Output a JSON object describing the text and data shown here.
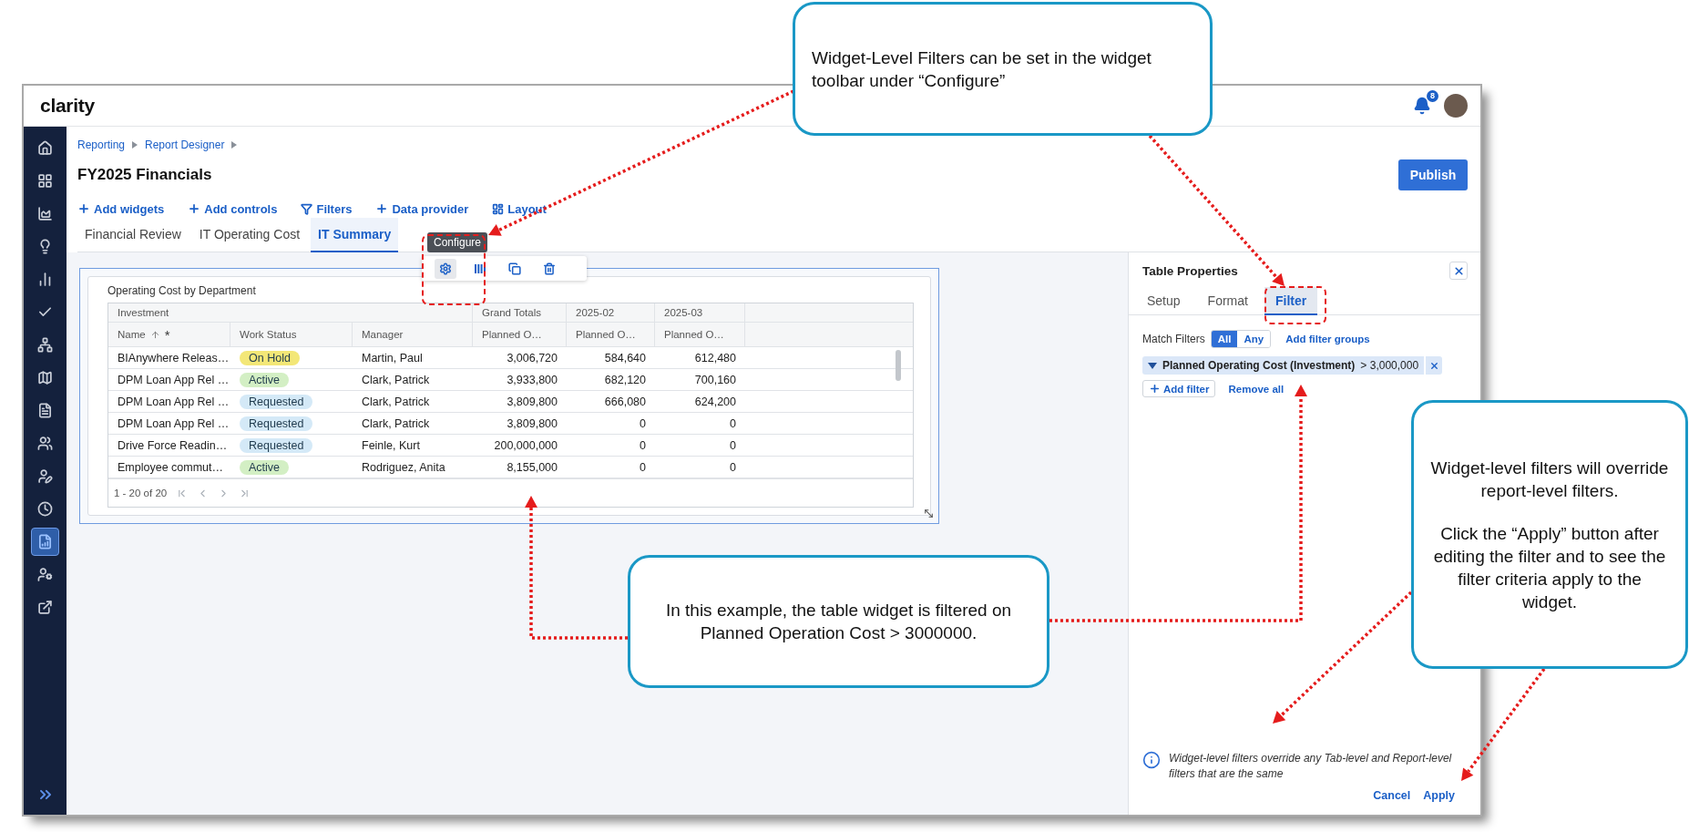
{
  "header": {
    "logo": "clarity",
    "notification_count": "8"
  },
  "sidebar": {
    "items": [
      {
        "selected": false
      },
      {
        "selected": false
      },
      {
        "selected": false
      },
      {
        "selected": false
      },
      {
        "selected": false
      },
      {
        "selected": false
      },
      {
        "selected": false
      },
      {
        "selected": false
      },
      {
        "selected": false
      },
      {
        "selected": false
      },
      {
        "selected": false
      },
      {
        "selected": false
      },
      {
        "selected": true
      },
      {
        "selected": false
      },
      {
        "selected": false
      }
    ]
  },
  "breadcrumbs": [
    "Reporting",
    "Report Designer"
  ],
  "page_title": "FY2025 Financials",
  "publish_button": "Publish",
  "toolbar": [
    {
      "label": "Add widgets",
      "kind": "add"
    },
    {
      "label": "Add controls",
      "kind": "add"
    },
    {
      "label": "Filters",
      "kind": "filter"
    },
    {
      "label": "Data provider",
      "kind": "add"
    },
    {
      "label": "Layout",
      "kind": "layout"
    }
  ],
  "tabs": [
    {
      "label": "Financial Review",
      "selected": false
    },
    {
      "label": "IT Operating Cost",
      "selected": false
    },
    {
      "label": "IT Summary",
      "selected": true
    }
  ],
  "widget": {
    "title": "Operating Cost by Department",
    "tooltip": "Configure",
    "tools": [
      {
        "kind": "configure",
        "selected": true
      },
      {
        "kind": "columns",
        "selected": false
      },
      {
        "kind": "copy",
        "selected": false
      },
      {
        "kind": "delete",
        "selected": false
      }
    ]
  },
  "table": {
    "column_groups": [
      {
        "label": "Investment",
        "kind": "wide"
      },
      {
        "label": "Grand Totals",
        "kind": "single"
      },
      {
        "label": "2025-02",
        "kind": "single"
      },
      {
        "label": "2025-03",
        "kind": "single"
      }
    ],
    "columns": [
      {
        "label": "Name",
        "sorted": true,
        "marker": "*"
      },
      {
        "label": "Work Status",
        "sorted": false
      },
      {
        "label": "Manager",
        "sorted": false
      },
      {
        "label": "Planned O…",
        "sorted": false
      },
      {
        "label": "Planned O…",
        "sorted": false
      },
      {
        "label": "Planned O…",
        "sorted": false
      }
    ],
    "rows": [
      {
        "name": "BIAnywhere Releas…",
        "status": {
          "label": "On Hold",
          "color": "#f3e777"
        },
        "manager": "Martin, Paul",
        "values": [
          "3,006,720",
          "584,640",
          "612,480"
        ]
      },
      {
        "name": "DPM Loan App Rel …",
        "status": {
          "label": "Active",
          "color": "#d3efc4"
        },
        "manager": "Clark, Patrick",
        "values": [
          "3,933,800",
          "682,120",
          "700,160"
        ]
      },
      {
        "name": "DPM Loan App Rel …",
        "status": {
          "label": "Requested",
          "color": "#d4e9f7"
        },
        "manager": "Clark, Patrick",
        "values": [
          "3,809,800",
          "666,080",
          "624,200"
        ]
      },
      {
        "name": "DPM Loan App Rel …",
        "status": {
          "label": "Requested",
          "color": "#d4e9f7"
        },
        "manager": "Clark, Patrick",
        "values": [
          "3,809,800",
          "0",
          "0"
        ]
      },
      {
        "name": "Drive Force Readin…",
        "status": {
          "label": "Requested",
          "color": "#d4e9f7"
        },
        "manager": "Feinle, Kurt",
        "values": [
          "200,000,000",
          "0",
          "0"
        ]
      },
      {
        "name": "Employee commut…",
        "status": {
          "label": "Active",
          "color": "#d3efc4"
        },
        "manager": "Rodriguez, Anita",
        "values": [
          "8,155,000",
          "0",
          "0"
        ]
      }
    ],
    "footer": "1 - 20 of 20"
  },
  "panel": {
    "title": "Table Properties",
    "tabs": [
      {
        "label": "Setup",
        "selected": false
      },
      {
        "label": "Format",
        "selected": false
      },
      {
        "label": "Filter",
        "selected": true
      }
    ],
    "match_label": "Match Filters",
    "match_options": [
      {
        "label": "All",
        "selected": true
      },
      {
        "label": "Any",
        "selected": false
      }
    ],
    "add_groups_link": "Add filter groups",
    "filters": [
      {
        "field": "Planned Operating Cost (Investment)",
        "condition": "> 3,000,000",
        "expanded": true
      }
    ],
    "add_filter_button": "Add filter",
    "remove_all_link": "Remove all",
    "note": "Widget-level filters override any Tab-level and Report-level filters that are the same",
    "buttons": [
      "Cancel",
      "Apply"
    ]
  },
  "callouts": [
    {
      "paragraphs": [
        "Widget-Level Filters can be set in the widget toolbar under “Configure”"
      ]
    },
    {
      "paragraphs": [
        "In this example, the table widget is filtered on Planned Operation Cost > 3000000."
      ]
    },
    {
      "paragraphs": [
        "Widget-level filters will override report-level filters.",
        "Click the “Apply” button after editing the filter and to see the filter criteria apply to the widget."
      ]
    }
  ]
}
